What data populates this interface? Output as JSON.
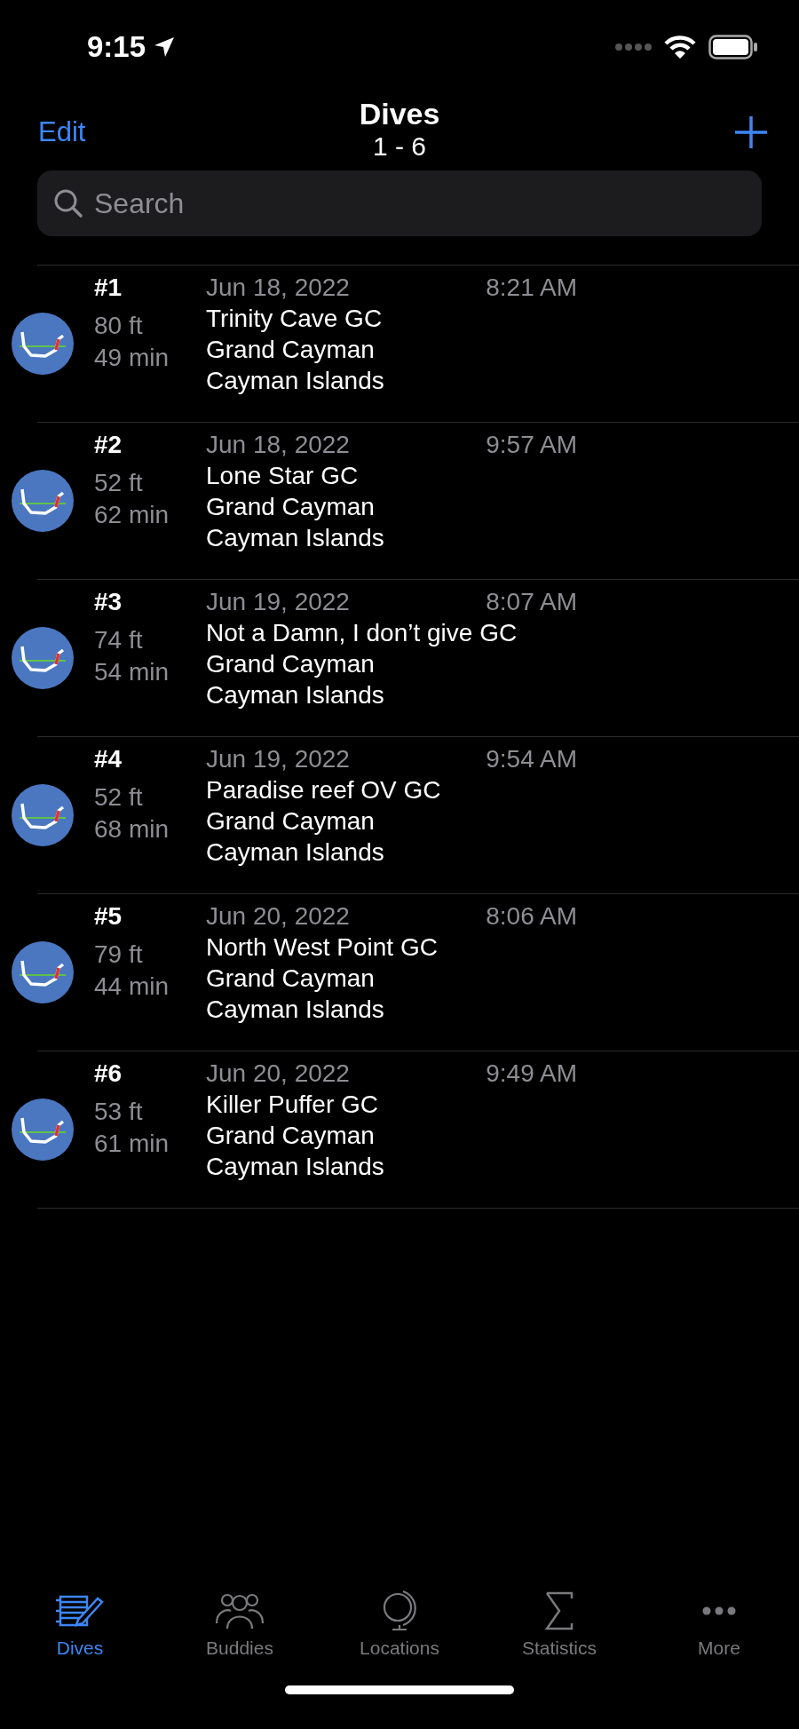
{
  "status_bar": {
    "time": "9:15"
  },
  "nav": {
    "edit": "Edit",
    "title": "Dives",
    "subtitle": "1 - 6"
  },
  "search": {
    "placeholder": "Search"
  },
  "dives": [
    {
      "number": "#1",
      "depth": "80 ft",
      "duration": "49 min",
      "date": "Jun 18, 2022",
      "time": "8:21 AM",
      "site": "Trinity Cave GC",
      "region": "Grand Cayman",
      "country": "Cayman Islands"
    },
    {
      "number": "#2",
      "depth": "52 ft",
      "duration": "62 min",
      "date": "Jun 18, 2022",
      "time": "9:57 AM",
      "site": "Lone Star GC",
      "region": "Grand Cayman",
      "country": "Cayman Islands"
    },
    {
      "number": "#3",
      "depth": "74 ft",
      "duration": "54 min",
      "date": "Jun 19, 2022",
      "time": "8:07 AM",
      "site": "Not a Damn, I don’t give GC",
      "region": "Grand Cayman",
      "country": "Cayman Islands"
    },
    {
      "number": "#4",
      "depth": "52 ft",
      "duration": "68 min",
      "date": "Jun 19, 2022",
      "time": "9:54 AM",
      "site": "Paradise reef OV GC",
      "region": "Grand Cayman",
      "country": "Cayman Islands"
    },
    {
      "number": "#5",
      "depth": "79 ft",
      "duration": "44 min",
      "date": "Jun 20, 2022",
      "time": "8:06 AM",
      "site": "North West Point GC",
      "region": "Grand Cayman",
      "country": "Cayman Islands"
    },
    {
      "number": "#6",
      "depth": "53 ft",
      "duration": "61 min",
      "date": "Jun 20, 2022",
      "time": "9:49 AM",
      "site": "Killer Puffer GC",
      "region": "Grand Cayman",
      "country": "Cayman Islands"
    }
  ],
  "tab_bar": [
    {
      "label": "Dives",
      "kind": "log",
      "selected": true
    },
    {
      "label": "Buddies",
      "kind": "people",
      "selected": false
    },
    {
      "label": "Locations",
      "kind": "globe",
      "selected": false
    },
    {
      "label": "Statistics",
      "kind": "sigma",
      "selected": false
    },
    {
      "label": "More",
      "kind": "more",
      "selected": false
    }
  ]
}
